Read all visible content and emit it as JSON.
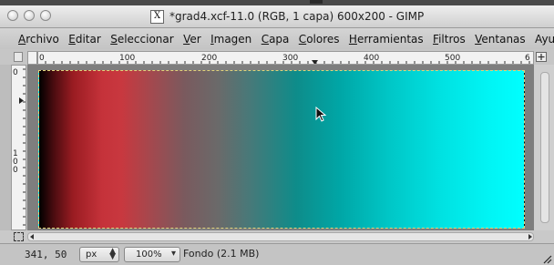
{
  "window": {
    "title": "*grad4.xcf-11.0 (RGB, 1 capa) 600x200 - GIMP",
    "title_icon": "X"
  },
  "menu": [
    {
      "pre": "",
      "u": "A",
      "post": "rchivo"
    },
    {
      "pre": "",
      "u": "E",
      "post": "ditar"
    },
    {
      "pre": "",
      "u": "S",
      "post": "eleccionar"
    },
    {
      "pre": "",
      "u": "V",
      "post": "er"
    },
    {
      "pre": "",
      "u": "I",
      "post": "magen"
    },
    {
      "pre": "",
      "u": "C",
      "post": "apa"
    },
    {
      "pre": "",
      "u": "C",
      "post": "olores"
    },
    {
      "pre": "",
      "u": "H",
      "post": "erramientas"
    },
    {
      "pre": "",
      "u": "F",
      "post": "iltros"
    },
    {
      "pre": "",
      "u": "V",
      "post": "entanas"
    },
    {
      "pre": "Ayu",
      "u": "d",
      "post": "a"
    }
  ],
  "ruler": {
    "h_labels": [
      "0",
      "100",
      "200",
      "300",
      "400",
      "500",
      "6"
    ],
    "v_labels": [
      "0",
      "1",
      "0",
      "0"
    ]
  },
  "canvas": {
    "gradient_from": "#000000",
    "gradient_mid": "#c5323a",
    "gradient_to": "#00ffff"
  },
  "status": {
    "coords": "341, 50",
    "unit": "px",
    "zoom": "100%",
    "layer": "Fondo (2.1 MB)"
  },
  "icons": [
    "navigate-icon",
    "quick-mask-icon",
    "mouse-pointer-icon",
    "resize-grip-icon"
  ]
}
